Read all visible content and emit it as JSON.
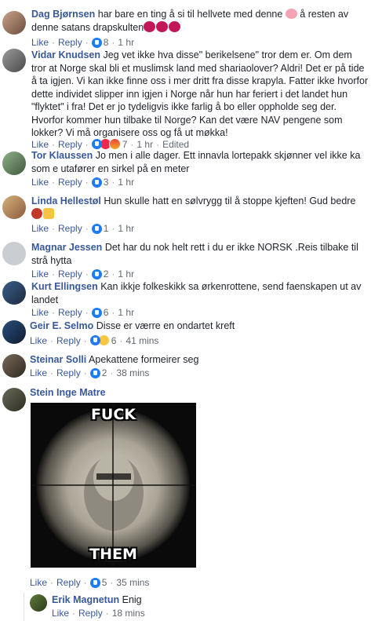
{
  "comments": [
    {
      "name": "Dag Bjørnsen",
      "text": "har bare en ting å si til hellvete med denne",
      "text2": "å resten av denne satans drapskulten",
      "like": "Like",
      "reply": "Reply",
      "count": "8",
      "time": "1 hr"
    },
    {
      "name": "Vidar Knudsen",
      "text": "Jeg vet ikke hva disse\" berikelsene\" tror dem er. Om dem tror at Norge skal bli et muslimsk land med shariaolover? Aldri! Det er på tide å ta igjen. Vi kan ikke finne oss i mer dritt fra disse krapyla. Fatter ikke hvorfor dette individet slipper inn igjen i Norge når hun har feriert i det landet hun \"flyktet\" i fra! Det er jo tydeligvis ikke farlig å bo eller oppholde seg der. Hvorfor kommer hun tilbake til Norge? Kan det være NAV pengene som lokker? Vi må organisere oss og få ut møkka!",
      "like": "Like",
      "reply": "Reply",
      "count": "7",
      "time": "1 hr",
      "edited": "Edited"
    },
    {
      "name": "Tor Klaussen",
      "text": "Jo men i alle dager. Ett innavla lortepakk skjønner vel ikke ka som e utafører en sirkel på en meter",
      "like": "Like",
      "reply": "Reply",
      "count": "3",
      "time": "1 hr"
    },
    {
      "name": "Linda Hellestøl",
      "text": "Hun skulle hatt en sølvrygg til å stoppe kjeften! Gud bedre",
      "like": "Like",
      "reply": "Reply",
      "count": "1",
      "time": "1 hr"
    },
    {
      "name": "Magnar Jessen",
      "text": "Det har du nok helt rett i du er ikke NORSK .Reis tilbake til strå hytta",
      "like": "Like",
      "reply": "Reply",
      "count": "2",
      "time": "1 hr"
    },
    {
      "name": "Kurt Ellingsen",
      "text": "Kan ikkje folkeskikk sa ørkenrottene, send faenskapen ut av landet",
      "like": "Like",
      "reply": "Reply",
      "count": "6",
      "time": "1 hr"
    },
    {
      "name": "Geir E. Selmo",
      "text": "Disse er værre en ondartet kreft",
      "like": "Like",
      "reply": "Reply",
      "count": "6",
      "time": "41 mins"
    },
    {
      "name": "Steinar Solli",
      "text": "Apekattene formeirer seg",
      "like": "Like",
      "reply": "Reply",
      "count": "2",
      "time": "38 mins"
    },
    {
      "name": "Stein Inge Matre",
      "meme_top": "FUCK",
      "meme_bottom": "THEM",
      "like": "Like",
      "reply": "Reply",
      "count": "5",
      "time": "35 mins"
    },
    {
      "name": "Erik Magnetun",
      "text": "Enig",
      "like": "Like",
      "reply": "Reply",
      "time": "18 mins"
    }
  ],
  "colors": {
    "link": "#385898",
    "meta": "#616770",
    "like_blue": "#1f7bf2"
  }
}
